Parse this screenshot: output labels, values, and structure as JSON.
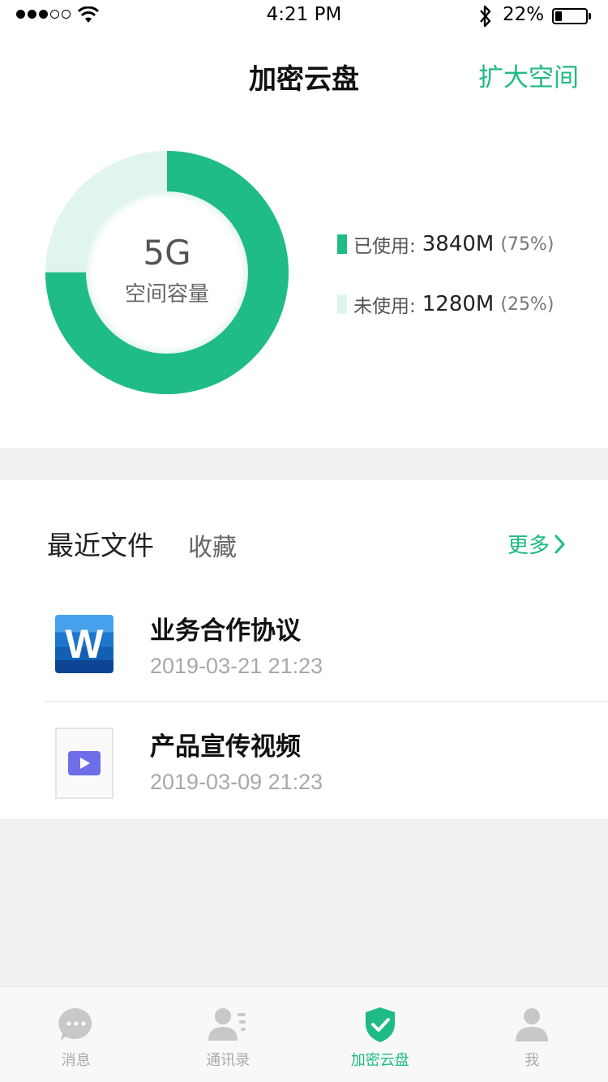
{
  "status_bar": {
    "time": "4:21 PM",
    "battery_percent": "22%",
    "battery_level": 0.22,
    "signal_bars_filled": 3,
    "signal_bars_total": 5
  },
  "nav": {
    "title": "加密云盘",
    "expand_label": "扩大空间"
  },
  "storage": {
    "total_label": "5G",
    "caption": "空间容量",
    "used": {
      "name": "已使用:",
      "value": "3840M",
      "percent": "(75%)",
      "fraction": 0.75,
      "color": "#1fbc86"
    },
    "unused": {
      "name": "未使用:",
      "value": "1280M",
      "percent": "(25%)",
      "fraction": 0.25,
      "color": "#dff5ee"
    }
  },
  "files": {
    "tab_recent": "最近文件",
    "tab_favorites": "收藏",
    "more_label": "更多",
    "items": [
      {
        "name": "业务合作协议",
        "date": "2019-03-21 21:23",
        "icon": "word-document-icon"
      },
      {
        "name": "产品宣传视频",
        "date": "2019-03-09 21:23",
        "icon": "video-file-icon"
      }
    ]
  },
  "tabbar": {
    "items": [
      {
        "label": "消息",
        "icon": "chat-bubble-icon",
        "active": false
      },
      {
        "label": "通讯录",
        "icon": "contacts-icon",
        "active": false
      },
      {
        "label": "加密云盘",
        "icon": "shield-check-icon",
        "active": true
      },
      {
        "label": "我",
        "icon": "person-icon",
        "active": false
      }
    ]
  },
  "colors": {
    "accent": "#1fbb84",
    "used": "#1fbc86",
    "unused": "#dff5ee"
  }
}
